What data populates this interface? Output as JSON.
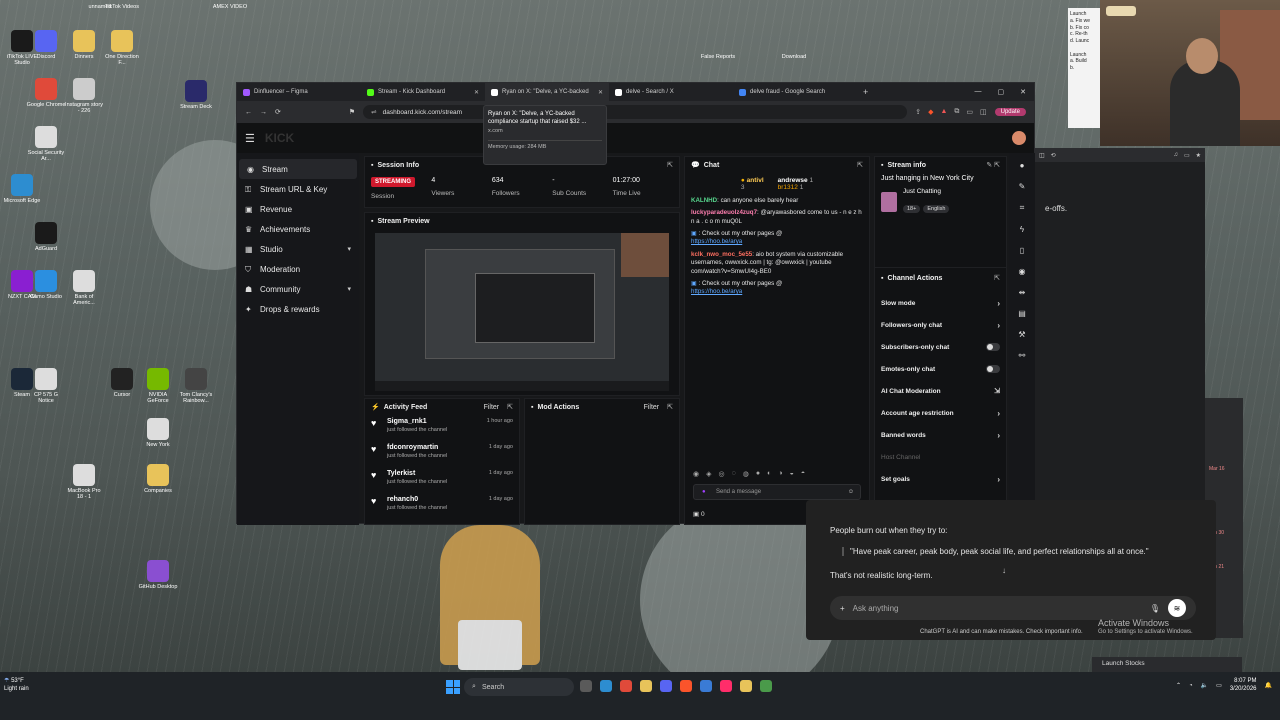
{
  "desktop": {
    "icons": [
      {
        "label": "iTikTok LIVE Studio",
        "color": "#1a1a1a"
      },
      {
        "label": "Discord",
        "color": "#5865f2"
      },
      {
        "label": "Dinners",
        "color": "#e8c35a"
      },
      {
        "label": "One Direction F...",
        "color": "#e8c35a"
      },
      {
        "label": "Google Chrome",
        "color": "#e04a3a"
      },
      {
        "label": "Instagram story - 226",
        "color": "#cccccc"
      },
      {
        "label": "Stream Deck",
        "color": "#2a2a6a"
      },
      {
        "label": "Social Security Ar...",
        "color": "#dddddd"
      },
      {
        "label": "Microsoft Edge",
        "color": "#2d8dd0"
      },
      {
        "label": "AdGuard",
        "color": "#1a1a1a"
      },
      {
        "label": "NZXT CAM",
        "color": "#8a1fd1"
      },
      {
        "label": "Camo Studio",
        "color": "#2b8fe0"
      },
      {
        "label": "Bank of Americ...",
        "color": "#dddddd"
      },
      {
        "label": "Steam",
        "color": "#1b2838"
      },
      {
        "label": "CP 575 G Notice",
        "color": "#dddddd"
      },
      {
        "label": "Cursor",
        "color": "#222222"
      },
      {
        "label": "NVIDIA GeForce",
        "color": "#76b900"
      },
      {
        "label": "Tom Clancy's Rainbow...",
        "color": "#444444"
      },
      {
        "label": "New York",
        "color": "#dddddd"
      },
      {
        "label": "MacBook Pro 18 - 1",
        "color": "#dddddd"
      },
      {
        "label": "Companies",
        "color": "#e8c35a"
      },
      {
        "label": "GitHub Desktop",
        "color": "#8a4fd1"
      }
    ],
    "top_labels": [
      "unnamed",
      "TikTok Videos",
      "AMEX VIDEO",
      "False Reports",
      "Download"
    ]
  },
  "browser": {
    "tabs": [
      {
        "title": "Dinfluencer – Figma",
        "active": false,
        "color": "#a259ff"
      },
      {
        "title": "Stream - Kick Dashboard",
        "active": false,
        "color": "#53fc18"
      },
      {
        "title": "Ryan on X: \"Delve, a YC-backed",
        "active": true,
        "color": "#ffffff"
      },
      {
        "title": "delve - Search / X",
        "active": false,
        "color": "#ffffff"
      },
      {
        "title": "delve fraud - Google Search",
        "active": false,
        "color": "#4285f4"
      }
    ],
    "url": "dashboard.kick.com/stream",
    "update_label": "Update",
    "tooltip": {
      "title": "Ryan on X: \"Delve, a YC-backed compliance startup that raised $32 ...",
      "domain": "x.com",
      "memory": "Memory usage: 284 MB"
    }
  },
  "sidebar": {
    "items": [
      {
        "label": "Stream",
        "icon": "broadcast-icon",
        "active": true,
        "chevron": false
      },
      {
        "label": "Stream URL & Key",
        "icon": "key-icon",
        "active": false,
        "chevron": false
      },
      {
        "label": "Revenue",
        "icon": "dollar-icon",
        "active": false,
        "chevron": false
      },
      {
        "label": "Achievements",
        "icon": "trophy-icon",
        "active": false,
        "chevron": false
      },
      {
        "label": "Studio",
        "icon": "studio-icon",
        "active": false,
        "chevron": true
      },
      {
        "label": "Moderation",
        "icon": "shield-icon",
        "active": false,
        "chevron": false
      },
      {
        "label": "Community",
        "icon": "community-icon",
        "active": false,
        "chevron": true
      },
      {
        "label": "Drops & rewards",
        "icon": "gift-icon",
        "active": false,
        "chevron": false
      }
    ]
  },
  "session": {
    "title": "Session Info",
    "status": "STREAMING",
    "status_label": "Session",
    "stats": [
      {
        "value": "4",
        "label": "Viewers"
      },
      {
        "value": "634",
        "label": "Followers"
      },
      {
        "value": "-",
        "label": "Sub Counts"
      },
      {
        "value": "01:27:00",
        "label": "Time Live"
      }
    ]
  },
  "preview": {
    "title": "Stream Preview"
  },
  "activity": {
    "title": "Activity Feed",
    "filter": "Filter",
    "items": [
      {
        "name": "Sigma_rnk1",
        "sub": "just followed the channel",
        "time": "1 hour ago"
      },
      {
        "name": "fdconroymartin",
        "sub": "just followed the channel",
        "time": "1 day ago"
      },
      {
        "name": "Tylerkist",
        "sub": "just followed the channel",
        "time": "1 day ago"
      },
      {
        "name": "rehanch0",
        "sub": "just followed the channel",
        "time": "1 day ago"
      }
    ]
  },
  "mod_actions": {
    "title": "Mod Actions",
    "filter": "Filter"
  },
  "chat": {
    "title": "Chat",
    "top_users": [
      {
        "name": "antivl",
        "count": "3"
      },
      {
        "name": "andrewse",
        "count": "1"
      },
      {
        "name": "br1312",
        "count": "1"
      }
    ],
    "messages": [
      {
        "user": "KALNHD",
        "color": "u-green",
        "text": ": can anyone else barely hear",
        "link": ""
      },
      {
        "user": "luckyparadeuolz4zuq7",
        "color": "u-pink",
        "text": ": @aryawasbored come to us - n e z h n a . c o m muQ0L",
        "link": ""
      },
      {
        "user": "",
        "color": "u-green",
        "text": ": Check out my other pages @",
        "link": "https://hoo.be/arya"
      },
      {
        "user": "kclk_nwo_moc_5e55",
        "color": "u-red",
        "text": ": aio bot system via customizable usernames, owwxick.com | tg: @owwxick | youtube com/watch?v=SmwUI4g-BE0",
        "link": ""
      },
      {
        "user": "",
        "color": "u-green",
        "text": ": Check out my other pages @",
        "link": "https://hoo.be/arya"
      }
    ],
    "input_placeholder": "Send a message",
    "footer_count": "0"
  },
  "stream_info": {
    "title": "Stream info",
    "stream_title": "Just hanging in New York City",
    "category": "Just Chatting",
    "tags": [
      "18+",
      "English"
    ]
  },
  "channel_actions": {
    "title": "Channel Actions",
    "items": [
      {
        "label": "Slow mode",
        "type": "arrow"
      },
      {
        "label": "Followers-only chat",
        "type": "arrow"
      },
      {
        "label": "Subscribers-only chat",
        "type": "toggle"
      },
      {
        "label": "Emotes-only chat",
        "type": "toggle"
      },
      {
        "label": "AI Chat Moderation",
        "type": "external"
      },
      {
        "label": "Account age restriction",
        "type": "arrow"
      },
      {
        "label": "Banned words",
        "type": "arrow"
      },
      {
        "label": "Host Channel",
        "type": "disabled"
      },
      {
        "label": "Set goals",
        "type": "arrow"
      }
    ]
  },
  "chatgpt": {
    "line1": "People burn out when they try to:",
    "quote": "\"Have peak career, peak body, peak social life, and perfect relationships all at once.\"",
    "line2": "That's not realistic long-term.",
    "placeholder": "Ask anything",
    "disclaimer": "ChatGPT is AI and can make mistakes. Check important info."
  },
  "right_window": {
    "text": "e-offs.",
    "dates": [
      "Mar 16",
      "Jan 30",
      "Jan 21"
    ]
  },
  "notes": {
    "text": "Launch\na. Fix we\nb. Fix co\nc. Re-th\nd. Launc\n\nLaunch\na. Build\nb."
  },
  "launch_stocks": "Launch Stocks",
  "activate": {
    "title": "Activate Windows",
    "sub": "Go to Settings to activate Windows."
  },
  "taskbar": {
    "weather_temp": "53°F",
    "weather_desc": "Light rain",
    "search": "Search",
    "time": "8:07 PM",
    "date": "3/20/2026"
  }
}
